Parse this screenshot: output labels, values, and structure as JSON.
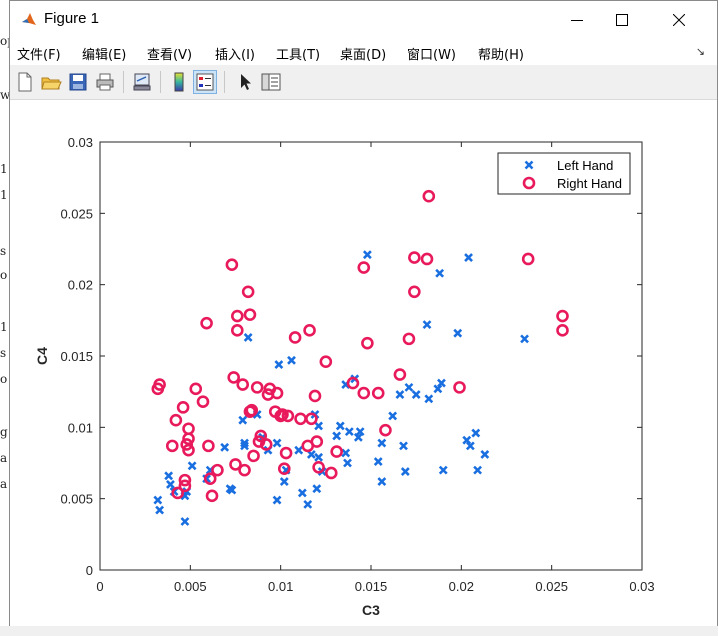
{
  "window": {
    "title": "Figure 1"
  },
  "menu": [
    "文件(F)",
    "编辑(E)",
    "查看(V)",
    "插入(I)",
    "工具(T)",
    "桌面(D)",
    "窗口(W)",
    "帮助(H)"
  ],
  "toolbar": {
    "icons": [
      "new-figure-icon",
      "open-file-icon",
      "save-icon",
      "print-icon",
      "link-plot-icon",
      "insert-colorbar-icon",
      "insert-legend-icon",
      "edit-plot-icon",
      "property-inspector-icon"
    ]
  },
  "background_text": [
    "op",
    "w",
    "1",
    "1",
    "s",
    "o",
    "1",
    "s",
    "o",
    "g",
    "a",
    "a"
  ],
  "chart_data": {
    "type": "scatter",
    "xlabel": "C3",
    "ylabel": "C4",
    "xlim": [
      0,
      0.03
    ],
    "ylim": [
      0,
      0.03
    ],
    "xticks": [
      "0",
      "0.005",
      "0.01",
      "0.015",
      "0.02",
      "0.025",
      "0.03"
    ],
    "yticks": [
      "0",
      "0.005",
      "0.01",
      "0.015",
      "0.02",
      "0.025",
      "0.03"
    ],
    "grid": false,
    "legend_position": "top-right",
    "series": [
      {
        "name": "Left Hand",
        "marker": "x",
        "color": "#1a6fe0",
        "points": [
          [
            0.0032,
            0.0049
          ],
          [
            0.0033,
            0.0042
          ],
          [
            0.0038,
            0.0066
          ],
          [
            0.0039,
            0.006
          ],
          [
            0.0041,
            0.0055
          ],
          [
            0.0047,
            0.0034
          ],
          [
            0.0047,
            0.0052
          ],
          [
            0.0048,
            0.0055
          ],
          [
            0.0051,
            0.0073
          ],
          [
            0.0059,
            0.0064
          ],
          [
            0.0061,
            0.007
          ],
          [
            0.0069,
            0.0086
          ],
          [
            0.0072,
            0.0057
          ],
          [
            0.0073,
            0.0056
          ],
          [
            0.0079,
            0.0105
          ],
          [
            0.008,
            0.0089
          ],
          [
            0.008,
            0.0087
          ],
          [
            0.0082,
            0.0163
          ],
          [
            0.0087,
            0.0109
          ],
          [
            0.009,
            0.0093
          ],
          [
            0.0093,
            0.0084
          ],
          [
            0.0098,
            0.0049
          ],
          [
            0.0098,
            0.0089
          ],
          [
            0.0099,
            0.0144
          ],
          [
            0.0102,
            0.0062
          ],
          [
            0.0103,
            0.007
          ],
          [
            0.0106,
            0.0147
          ],
          [
            0.011,
            0.0084
          ],
          [
            0.0112,
            0.0054
          ],
          [
            0.0115,
            0.0046
          ],
          [
            0.0117,
            0.0081
          ],
          [
            0.0119,
            0.0109
          ],
          [
            0.0121,
            0.0101
          ],
          [
            0.0121,
            0.0079
          ],
          [
            0.012,
            0.0057
          ],
          [
            0.0123,
            0.0069
          ],
          [
            0.0131,
            0.0094
          ],
          [
            0.0133,
            0.0101
          ],
          [
            0.0136,
            0.0082
          ],
          [
            0.0137,
            0.0075
          ],
          [
            0.0138,
            0.0097
          ],
          [
            0.0136,
            0.013
          ],
          [
            0.0141,
            0.0134
          ],
          [
            0.0143,
            0.0093
          ],
          [
            0.0144,
            0.0097
          ],
          [
            0.0148,
            0.0221
          ],
          [
            0.0154,
            0.0076
          ],
          [
            0.0156,
            0.0062
          ],
          [
            0.0156,
            0.0089
          ],
          [
            0.0162,
            0.0108
          ],
          [
            0.0166,
            0.0123
          ],
          [
            0.0168,
            0.0087
          ],
          [
            0.0169,
            0.0069
          ],
          [
            0.0171,
            0.0128
          ],
          [
            0.0175,
            0.0123
          ],
          [
            0.0182,
            0.012
          ],
          [
            0.0181,
            0.0172
          ],
          [
            0.0187,
            0.0127
          ],
          [
            0.0188,
            0.0208
          ],
          [
            0.0189,
            0.0131
          ],
          [
            0.019,
            0.007
          ],
          [
            0.0198,
            0.0166
          ],
          [
            0.0203,
            0.0091
          ],
          [
            0.0204,
            0.0219
          ],
          [
            0.0205,
            0.0087
          ],
          [
            0.0208,
            0.0096
          ],
          [
            0.0209,
            0.007
          ],
          [
            0.0213,
            0.0081
          ],
          [
            0.0235,
            0.0162
          ]
        ]
      },
      {
        "name": "Right Hand",
        "marker": "o",
        "color": "#e81a5c",
        "points": [
          [
            0.0032,
            0.0127
          ],
          [
            0.0033,
            0.013
          ],
          [
            0.004,
            0.0087
          ],
          [
            0.0042,
            0.0105
          ],
          [
            0.0043,
            0.0054
          ],
          [
            0.0046,
            0.0114
          ],
          [
            0.0047,
            0.0063
          ],
          [
            0.0047,
            0.0059
          ],
          [
            0.0048,
            0.0088
          ],
          [
            0.0049,
            0.0092
          ],
          [
            0.0049,
            0.0084
          ],
          [
            0.0049,
            0.0099
          ],
          [
            0.0053,
            0.0127
          ],
          [
            0.0057,
            0.0118
          ],
          [
            0.0059,
            0.0173
          ],
          [
            0.006,
            0.0087
          ],
          [
            0.0061,
            0.0064
          ],
          [
            0.0062,
            0.0052
          ],
          [
            0.0065,
            0.007
          ],
          [
            0.0073,
            0.0214
          ],
          [
            0.0074,
            0.0135
          ],
          [
            0.0075,
            0.0074
          ],
          [
            0.0076,
            0.0168
          ],
          [
            0.0076,
            0.0178
          ],
          [
            0.0079,
            0.013
          ],
          [
            0.008,
            0.007
          ],
          [
            0.0082,
            0.0195
          ],
          [
            0.0083,
            0.0111
          ],
          [
            0.0083,
            0.0179
          ],
          [
            0.0084,
            0.0112
          ],
          [
            0.0085,
            0.008
          ],
          [
            0.0087,
            0.0128
          ],
          [
            0.0088,
            0.009
          ],
          [
            0.0089,
            0.0094
          ],
          [
            0.0092,
            0.0088
          ],
          [
            0.0093,
            0.0123
          ],
          [
            0.0094,
            0.0127
          ],
          [
            0.0097,
            0.0111
          ],
          [
            0.0098,
            0.0124
          ],
          [
            0.01,
            0.0108
          ],
          [
            0.0101,
            0.0109
          ],
          [
            0.0102,
            0.0071
          ],
          [
            0.0103,
            0.0082
          ],
          [
            0.0104,
            0.0108
          ],
          [
            0.0108,
            0.0163
          ],
          [
            0.0111,
            0.0106
          ],
          [
            0.0115,
            0.0087
          ],
          [
            0.0116,
            0.0168
          ],
          [
            0.0117,
            0.0106
          ],
          [
            0.0119,
            0.0122
          ],
          [
            0.012,
            0.009
          ],
          [
            0.0121,
            0.0072
          ],
          [
            0.0125,
            0.0146
          ],
          [
            0.0128,
            0.0068
          ],
          [
            0.0131,
            0.0083
          ],
          [
            0.014,
            0.0131
          ],
          [
            0.0146,
            0.0124
          ],
          [
            0.0146,
            0.0212
          ],
          [
            0.0148,
            0.0159
          ],
          [
            0.0154,
            0.0124
          ],
          [
            0.0158,
            0.0098
          ],
          [
            0.0166,
            0.0137
          ],
          [
            0.0171,
            0.0162
          ],
          [
            0.0174,
            0.0219
          ],
          [
            0.0174,
            0.0195
          ],
          [
            0.0181,
            0.0218
          ],
          [
            0.0182,
            0.0262
          ],
          [
            0.0199,
            0.0128
          ],
          [
            0.0237,
            0.0218
          ],
          [
            0.0256,
            0.0178
          ],
          [
            0.0256,
            0.0168
          ]
        ]
      }
    ]
  }
}
